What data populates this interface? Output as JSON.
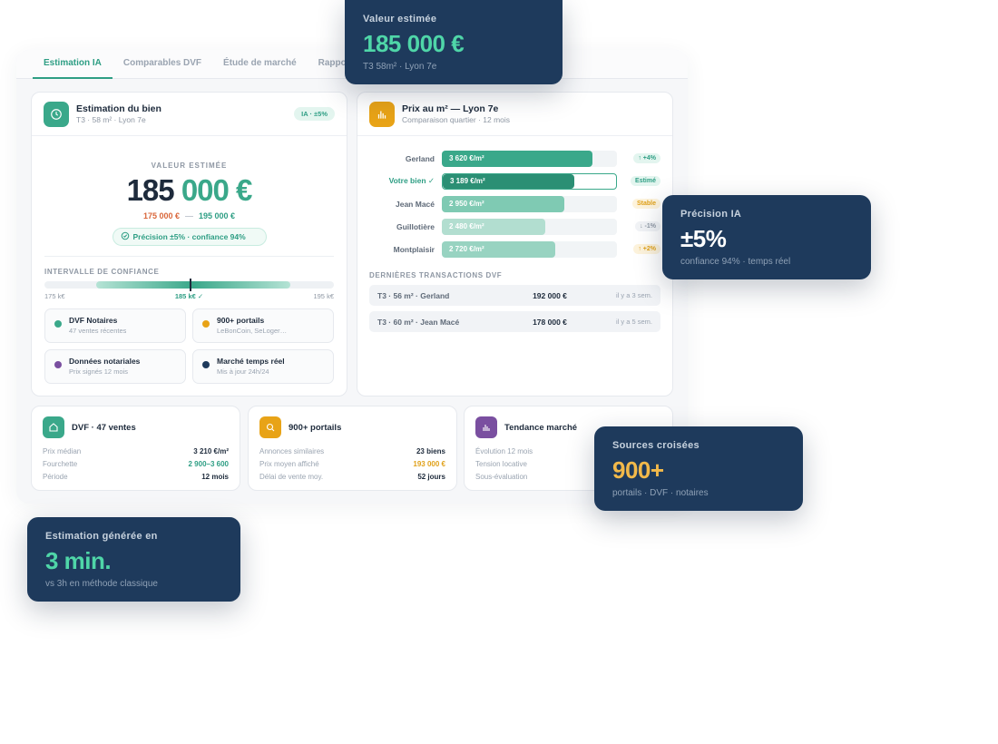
{
  "tabs": [
    {
      "label": "Estimation IA",
      "active": true
    },
    {
      "label": "Comparables DVF",
      "active": false
    },
    {
      "label": "Étude de marché",
      "active": false
    },
    {
      "label": "Rapport",
      "active": false
    }
  ],
  "estimation": {
    "title": "Estimation du bien",
    "subtitle": "T3 · 58 m² · Lyon 7e",
    "badge": "IA · ±5%",
    "value_label": "VALEUR ESTIMÉE",
    "value_part1": "185",
    "value_part2": "000 €",
    "range_low": "175 000 €",
    "range_sep": "—",
    "range_high": "195 000 €",
    "precision": "Précision ±5% · confiance 94%",
    "ci_label": "INTERVALLE DE CONFIANCE",
    "ci_low": "175 k€",
    "ci_mid": "185 k€ ✓",
    "ci_high": "195 k€",
    "sources": [
      {
        "title": "DVF Notaires",
        "sub": "47 ventes récentes",
        "color": "#3aa88a"
      },
      {
        "title": "900+ portails",
        "sub": "LeBonCoin, SeLoger…",
        "color": "#e8a317"
      },
      {
        "title": "Données notariales",
        "sub": "Prix signés 12 mois",
        "color": "#7a4fa0"
      },
      {
        "title": "Marché temps réel",
        "sub": "Mis à jour 24h/24",
        "color": "#1e3a5c"
      }
    ]
  },
  "price_m2": {
    "title": "Prix au m² — Lyon 7e",
    "subtitle": "Comparaison quartier · 12 mois",
    "rows": [
      {
        "label": "Gerland",
        "value_text": "3 620 €/m²",
        "value": 3620,
        "badge": "↑ +4%",
        "badge_bg": "#e3f5ef",
        "badge_fg": "#2e9e84",
        "fill": "#3aa88a",
        "me": false
      },
      {
        "label": "Votre bien ✓",
        "value_text": "3 189 €/m²",
        "value": 3189,
        "badge": "Estimé",
        "badge_bg": "#e3f5ef",
        "badge_fg": "#2e9e84",
        "fill": "#2b8f74",
        "me": true
      },
      {
        "label": "Jean Macé",
        "value_text": "2 950 €/m²",
        "value": 2950,
        "badge": "Stable",
        "badge_bg": "#fdf3dc",
        "badge_fg": "#e0a11a",
        "fill": "#7fcab3",
        "me": false
      },
      {
        "label": "Guillotière",
        "value_text": "2 480 €/m²",
        "value": 2480,
        "badge": "↓ -1%",
        "badge_bg": "#f1f3f6",
        "badge_fg": "#8e97a3",
        "fill": "#b2ded0",
        "me": false
      },
      {
        "label": "Montplaisir",
        "value_text": "2 720 €/m²",
        "value": 2720,
        "badge": "↑ +2%",
        "badge_bg": "#fdf3dc",
        "badge_fg": "#e0a11a",
        "fill": "#98d3c1",
        "me": false
      }
    ],
    "tx_label": "DERNIÈRES TRANSACTIONS DVF",
    "transactions": [
      {
        "desc": "T3 · 56 m² · Gerland",
        "price": "192 000 €",
        "date": "il y a 3 sem."
      },
      {
        "desc": "T3 · 60 m² · Jean Macé",
        "price": "178 000 €",
        "date": "il y a 5 sem."
      }
    ]
  },
  "bottom_cards": [
    {
      "title": "DVF · 47 ventes",
      "icon": "home-icon",
      "color": "#3aa88a",
      "rows": [
        {
          "k": "Prix médian",
          "v": "3 210 €/m²",
          "vc": "#1e2b3c"
        },
        {
          "k": "Fourchette",
          "v": "2 900–3 600",
          "vc": "#2e9e84"
        },
        {
          "k": "Période",
          "v": "12 mois",
          "vc": "#1e2b3c"
        }
      ]
    },
    {
      "title": "900+ portails",
      "icon": "search-icon",
      "color": "#e8a317",
      "rows": [
        {
          "k": "Annonces similaires",
          "v": "23 biens",
          "vc": "#1e2b3c"
        },
        {
          "k": "Prix moyen affiché",
          "v": "193 000 €",
          "vc": "#e0a11a"
        },
        {
          "k": "Délai de vente moy.",
          "v": "52 jours",
          "vc": "#1e2b3c"
        }
      ]
    },
    {
      "title": "Tendance marché",
      "icon": "bar-chart-icon",
      "color": "#7a4fa0",
      "rows": [
        {
          "k": "Évolution 12 mois",
          "v": "",
          "vc": "#1e2b3c"
        },
        {
          "k": "Tension locative",
          "v": "",
          "vc": "#1e2b3c"
        },
        {
          "k": "Sous-évaluation",
          "v": "",
          "vc": "#1e2b3c"
        }
      ]
    }
  ],
  "floats": {
    "value": {
      "title": "Valeur estimée",
      "value": "185 000 €",
      "sub": "T3 58m² · Lyon 7e",
      "color": "#4fd6a8"
    },
    "precision": {
      "title": "Précision IA",
      "value": "±5%",
      "sub": "confiance 94% · temps réel",
      "color": "#ffffff"
    },
    "sources": {
      "title": "Sources croisées",
      "value": "900+",
      "sub": "portails · DVF · notaires",
      "color": "#f2b94a"
    },
    "time": {
      "title": "Estimation générée en",
      "value": "3 min.",
      "sub": "vs 3h en méthode classique",
      "color": "#4fd6a8"
    }
  }
}
